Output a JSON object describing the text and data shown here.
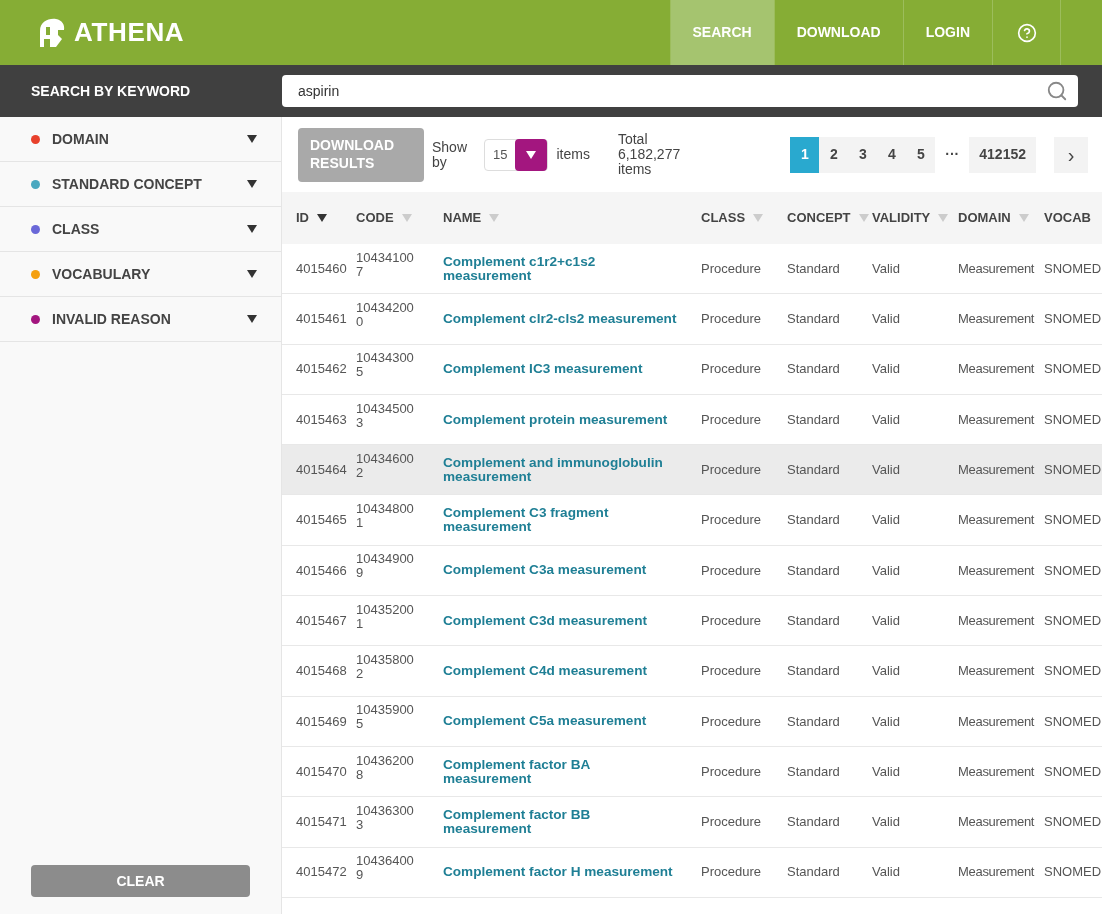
{
  "brand": "ATHENA",
  "nav": [
    {
      "label": "SEARCH",
      "selected": true
    },
    {
      "label": "DOWNLOAD",
      "selected": false
    },
    {
      "label": "LOGIN",
      "selected": false
    },
    {
      "kind": "help",
      "selected": false
    }
  ],
  "search": {
    "label": "SEARCH BY KEYWORD",
    "value": "aspirin"
  },
  "filters": [
    {
      "label": "DOMAIN",
      "color": "#e8412c"
    },
    {
      "label": "STANDARD CONCEPT",
      "color": "#4aa8c0"
    },
    {
      "label": "CLASS",
      "color": "#6a68d8"
    },
    {
      "label": "VOCABULARY",
      "color": "#f5a00f"
    },
    {
      "label": "INVALID REASON",
      "color": "#a3167f"
    }
  ],
  "clear_button": "CLEAR",
  "download_button": {
    "label": "DOWNLOAD RESULTS",
    "disabled": true
  },
  "show_by": {
    "label": "Show by",
    "value": "15",
    "suffix": "items"
  },
  "total": "Total 6,182,277 items",
  "pages": [
    {
      "label": "1",
      "selected": true
    },
    {
      "label": "2",
      "selected": false
    },
    {
      "label": "3",
      "selected": false
    },
    {
      "label": "4",
      "selected": false
    },
    {
      "label": "5",
      "selected": false
    }
  ],
  "ellipsis": "···",
  "last_page": "412152",
  "next": "›",
  "columns": [
    {
      "label": "ID",
      "sorted": true
    },
    {
      "label": "CODE",
      "sorted": false
    },
    {
      "label": "NAME",
      "sorted": false
    },
    {
      "label": "CLASS",
      "sorted": false
    },
    {
      "label": "CONCEPT",
      "sorted": false
    },
    {
      "label": "VALIDITY",
      "sorted": false
    },
    {
      "label": "DOMAIN",
      "sorted": false
    },
    {
      "label": "VOCAB"
    }
  ],
  "rows": [
    {
      "id": "4015460",
      "code": "104341007",
      "name": "Complement c1r2+c1s2 measurement",
      "class": "Procedure",
      "concept": "Standard",
      "validity": "Valid",
      "domain": "Measurement",
      "vocab": "SNOMED",
      "highlighted": false
    },
    {
      "id": "4015461",
      "code": "104342000",
      "name": "Complement clr2-cls2 measurement",
      "class": "Procedure",
      "concept": "Standard",
      "validity": "Valid",
      "domain": "Measurement",
      "vocab": "SNOMED",
      "highlighted": false
    },
    {
      "id": "4015462",
      "code": "104343005",
      "name": "Complement IC3 measurement",
      "class": "Procedure",
      "concept": "Standard",
      "validity": "Valid",
      "domain": "Measurement",
      "vocab": "SNOMED",
      "highlighted": false
    },
    {
      "id": "4015463",
      "code": "104345003",
      "name": "Complement protein measurement",
      "class": "Procedure",
      "concept": "Standard",
      "validity": "Valid",
      "domain": "Measurement",
      "vocab": "SNOMED",
      "highlighted": false
    },
    {
      "id": "4015464",
      "code": "104346002",
      "name": "Complement and immunoglobulin measurement",
      "class": "Procedure",
      "concept": "Standard",
      "validity": "Valid",
      "domain": "Measurement",
      "vocab": "SNOMED",
      "highlighted": true
    },
    {
      "id": "4015465",
      "code": "104348001",
      "name": "Complement C3 fragment measurement",
      "class": "Procedure",
      "concept": "Standard",
      "validity": "Valid",
      "domain": "Measurement",
      "vocab": "SNOMED",
      "highlighted": false
    },
    {
      "id": "4015466",
      "code": "104349009",
      "name": "Complement C3a measurement",
      "class": "Procedure",
      "concept": "Standard",
      "validity": "Valid",
      "domain": "Measurement",
      "vocab": "SNOMED",
      "highlighted": false
    },
    {
      "id": "4015467",
      "code": "104352001",
      "name": "Complement C3d measurement",
      "class": "Procedure",
      "concept": "Standard",
      "validity": "Valid",
      "domain": "Measurement",
      "vocab": "SNOMED",
      "highlighted": false
    },
    {
      "id": "4015468",
      "code": "104358002",
      "name": "Complement C4d measurement",
      "class": "Procedure",
      "concept": "Standard",
      "validity": "Valid",
      "domain": "Measurement",
      "vocab": "SNOMED",
      "highlighted": false
    },
    {
      "id": "4015469",
      "code": "104359005",
      "name": "Complement C5a measurement",
      "class": "Procedure",
      "concept": "Standard",
      "validity": "Valid",
      "domain": "Measurement",
      "vocab": "SNOMED",
      "highlighted": false
    },
    {
      "id": "4015470",
      "code": "104362008",
      "name": "Complement factor BA measurement",
      "class": "Procedure",
      "concept": "Standard",
      "validity": "Valid",
      "domain": "Measurement",
      "vocab": "SNOMED",
      "highlighted": false
    },
    {
      "id": "4015471",
      "code": "104363003",
      "name": "Complement factor BB measurement",
      "class": "Procedure",
      "concept": "Standard",
      "validity": "Valid",
      "domain": "Measurement",
      "vocab": "SNOMED",
      "highlighted": false
    },
    {
      "id": "4015472",
      "code": "104364009",
      "name": "Complement factor H measurement",
      "class": "Procedure",
      "concept": "Standard",
      "validity": "Valid",
      "domain": "Measurement",
      "vocab": "SNOMED",
      "highlighted": false
    }
  ]
}
